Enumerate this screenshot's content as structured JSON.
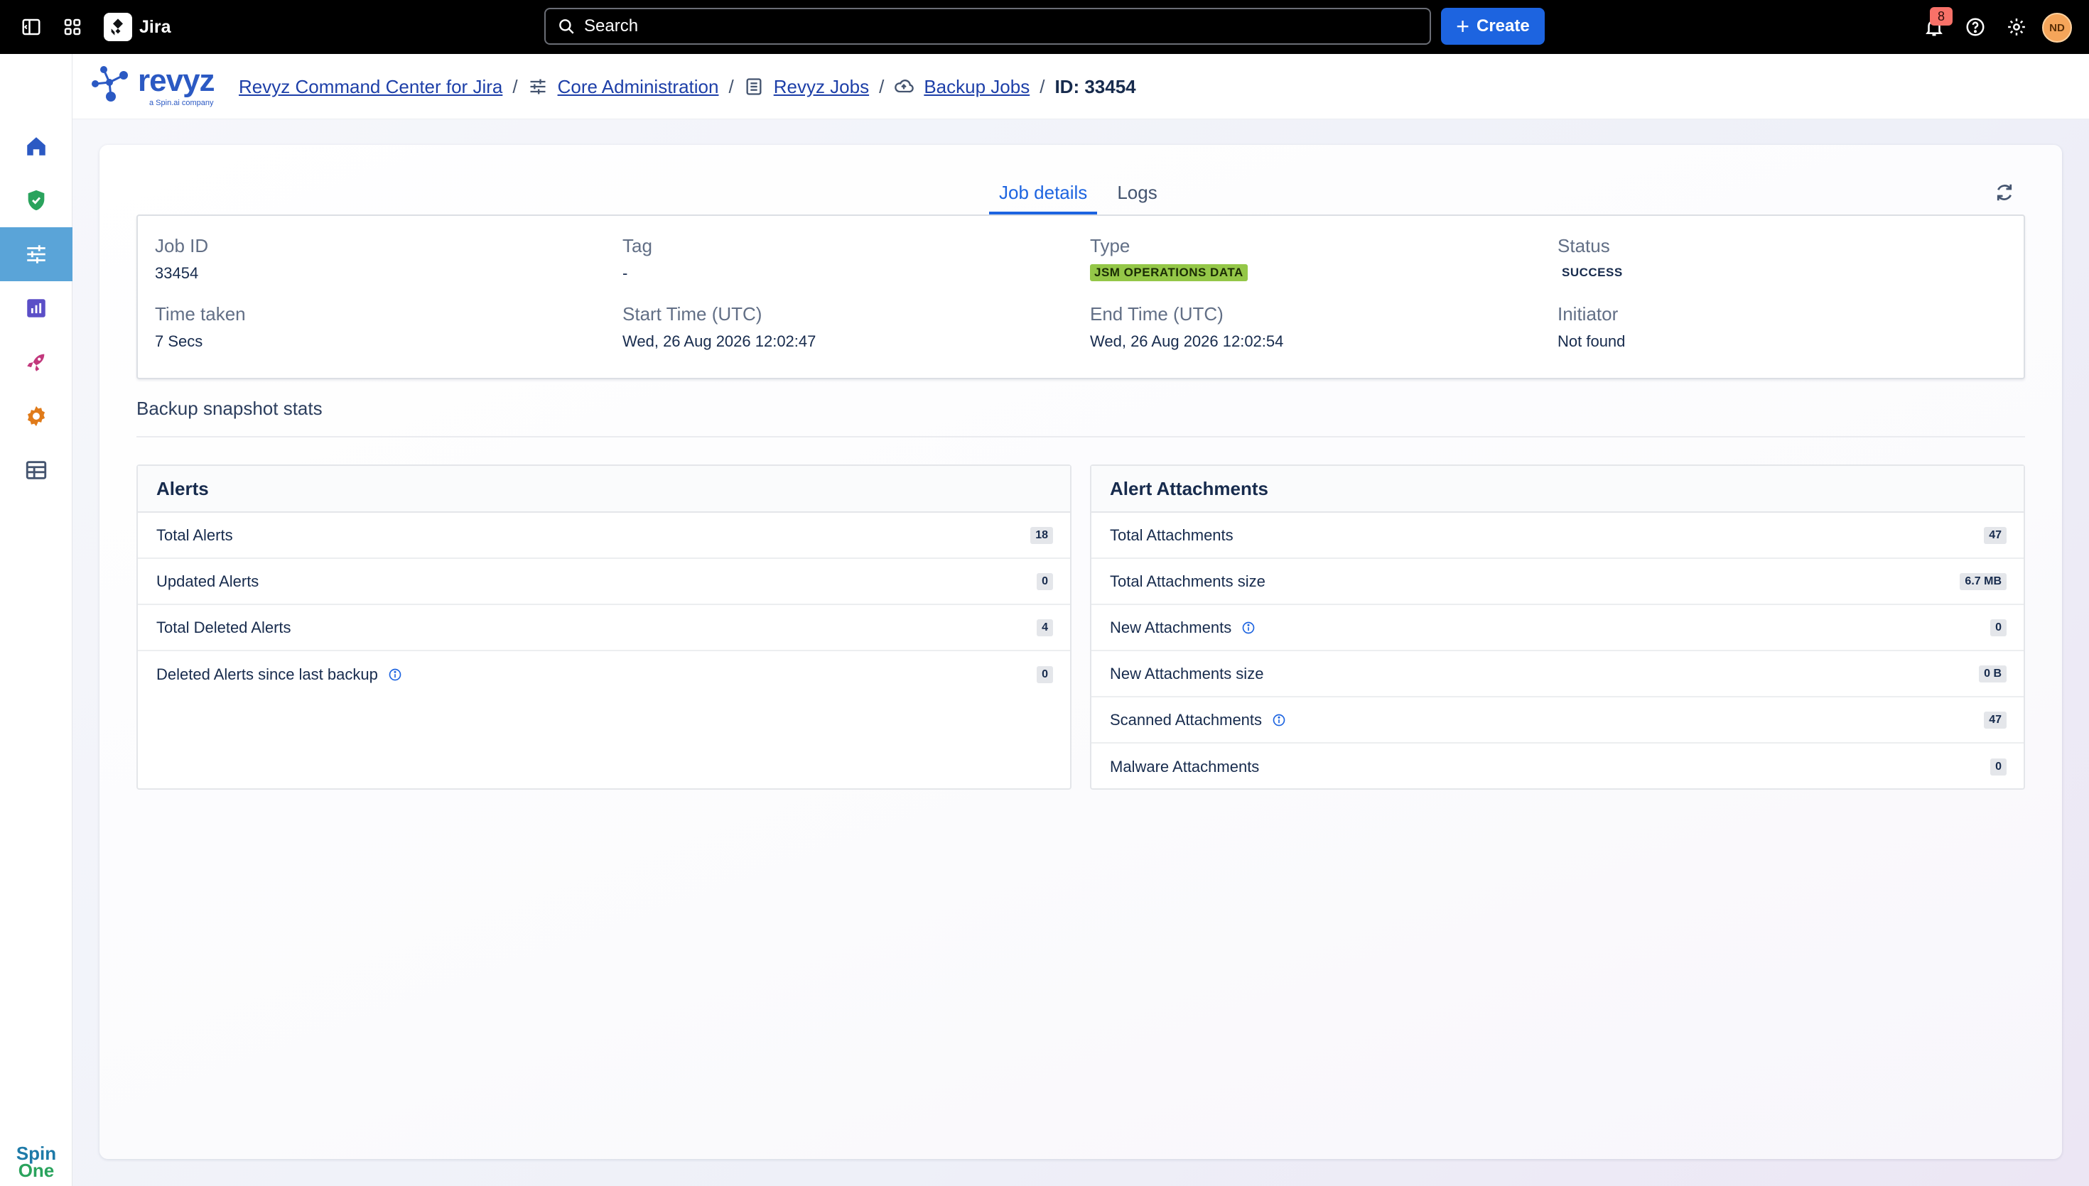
{
  "topbar": {
    "app_name": "Jira",
    "search_placeholder": "Search",
    "create_label": "Create",
    "notifications_count": "8",
    "avatar_initials": "ND"
  },
  "header": {
    "brand": "revyz",
    "brand_sub": "a Spin.ai company",
    "breadcrumb": {
      "item1": "Revyz Command Center for Jira",
      "item2": "Core Administration",
      "item3": "Revyz Jobs",
      "item4": "Backup Jobs",
      "current": "ID: 33454"
    }
  },
  "sidebar": {
    "footer_line1": "Spin",
    "footer_line2": "One"
  },
  "tabs": {
    "job_details": "Job details",
    "logs": "Logs"
  },
  "details": {
    "job_id_label": "Job ID",
    "job_id": "33454",
    "tag_label": "Tag",
    "tag": "-",
    "type_label": "Type",
    "type": "JSM OPERATIONS DATA",
    "status_label": "Status",
    "status": "SUCCESS",
    "time_taken_label": "Time taken",
    "time_taken": "7 Secs",
    "start_label": "Start Time (UTC)",
    "start": "Wed, 26 Aug 2026 12:02:47",
    "end_label": "End Time (UTC)",
    "end": "Wed, 26 Aug 2026 12:02:54",
    "initiator_label": "Initiator",
    "initiator": "Not found"
  },
  "snapshot": {
    "title": "Backup snapshot stats"
  },
  "alerts": {
    "title": "Alerts",
    "rows": [
      {
        "label": "Total Alerts",
        "value": "18"
      },
      {
        "label": "Updated Alerts",
        "value": "0"
      },
      {
        "label": "Total Deleted Alerts",
        "value": "4"
      },
      {
        "label": "Deleted Alerts since last backup",
        "value": "0"
      }
    ]
  },
  "attachments": {
    "title": "Alert Attachments",
    "rows": [
      {
        "label": "Total Attachments",
        "value": "47"
      },
      {
        "label": "Total Attachments size",
        "value": "6.7 MB"
      },
      {
        "label": "New Attachments",
        "value": "0"
      },
      {
        "label": "New Attachments size",
        "value": "0 B"
      },
      {
        "label": "Scanned Attachments",
        "value": "47"
      },
      {
        "label": "Malware Attachments",
        "value": "0"
      }
    ]
  },
  "colors": {
    "accent": "#1d64e0",
    "type_lozenge": "#94c748",
    "brand": "#2b59c3"
  }
}
